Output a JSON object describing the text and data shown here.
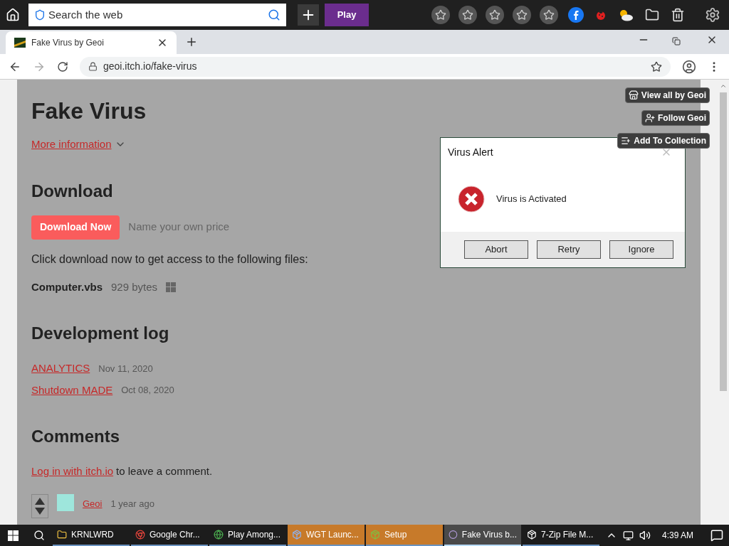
{
  "toolbar": {
    "search_placeholder": "Search the web",
    "play_button": "Play"
  },
  "tab": {
    "title": "Fake Virus by Geoi",
    "selected": true
  },
  "address": "geoi.itch.io/fake-virus",
  "page": {
    "title": "Fake Virus",
    "more_info": "More information",
    "download_heading": "Download",
    "download_button": "Download Now",
    "price_placeholder": "Name your own price",
    "description": "Click download now to get access to the following files:",
    "file": {
      "name": "Computer.vbs",
      "size": "929 bytes"
    },
    "devlog_heading": "Development log",
    "devlog": [
      {
        "title": "ANALYTICS",
        "date": "Nov 11, 2020"
      },
      {
        "title": "Shutdown MADE",
        "date": "Oct 08, 2020"
      }
    ],
    "comments_heading": "Comments",
    "login_link": "Log in with itch.io",
    "login_text": "to leave a comment.",
    "comment": {
      "author": "Geoi",
      "time": "1 year ago"
    }
  },
  "side_buttons": [
    {
      "kind": "store",
      "label": "View all by Geoi"
    },
    {
      "kind": "follow",
      "label": "Follow Geoi"
    },
    {
      "kind": "collection",
      "label": "Add To Collection"
    }
  ],
  "dialog": {
    "title": "Virus Alert",
    "message": "Virus is Activated",
    "buttons": [
      "Abort",
      "Retry",
      "Ignore"
    ]
  },
  "taskbar": {
    "items": [
      {
        "kind": "folder",
        "label": "KRNLWRD",
        "flashing": false,
        "selected": false
      },
      {
        "kind": "chrome",
        "label": "Google Chr...",
        "flashing": false,
        "selected": false
      },
      {
        "kind": "game",
        "label": "Play Among...",
        "flashing": false,
        "selected": false
      },
      {
        "kind": "launcher",
        "label": "WGT Launc...",
        "flashing": true,
        "selected": false
      },
      {
        "kind": "setup",
        "label": "Setup",
        "flashing": true,
        "selected": false
      },
      {
        "kind": "browser",
        "label": "Fake Virus b...",
        "flashing": false,
        "selected": true
      },
      {
        "kind": "zip",
        "label": "7-Zip File M...",
        "flashing": false,
        "selected": false
      }
    ],
    "time": "4:39 AM"
  }
}
